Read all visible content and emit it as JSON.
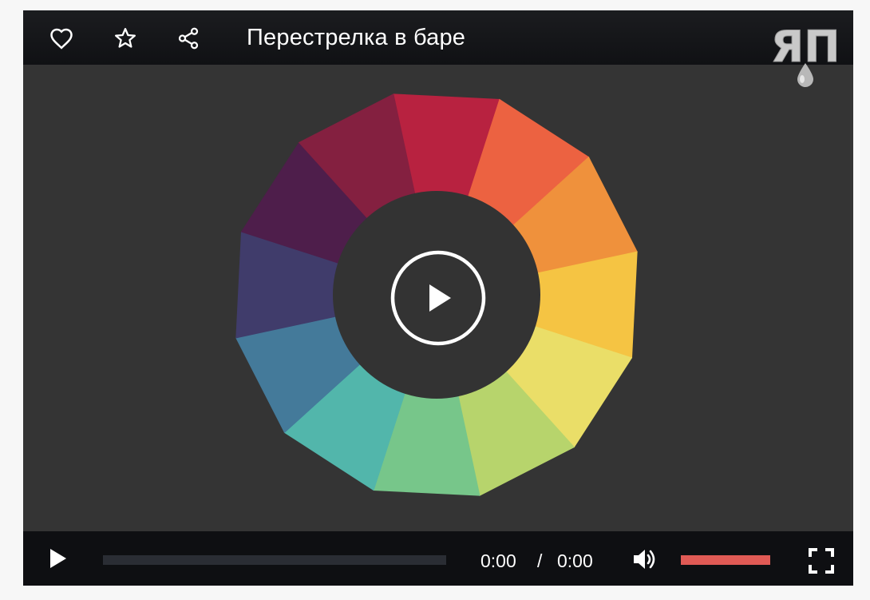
{
  "header": {
    "title": "Перестрелка в баре",
    "icons": [
      "heart-icon",
      "star-icon",
      "share-icon"
    ],
    "logo_text": "ЯП"
  },
  "center": {
    "play_icon": "play-icon"
  },
  "wheel": {
    "inner_color": "#333333",
    "segments": [
      "#b82240",
      "#ec6241",
      "#ef913c",
      "#f5c443",
      "#eade68",
      "#b7d46c",
      "#77c68a",
      "#52b6ab",
      "#447a9a",
      "#403c6b",
      "#4e1e4b",
      "#842040"
    ]
  },
  "controls": {
    "play_icon": "play-icon",
    "current_time": "0:00",
    "separator": "/",
    "duration": "0:00",
    "progress": 0,
    "volume_icon": "volume-icon",
    "volume_level": 1.0,
    "fullscreen_icon": "fullscreen-icon",
    "accent": "#e05a55"
  }
}
